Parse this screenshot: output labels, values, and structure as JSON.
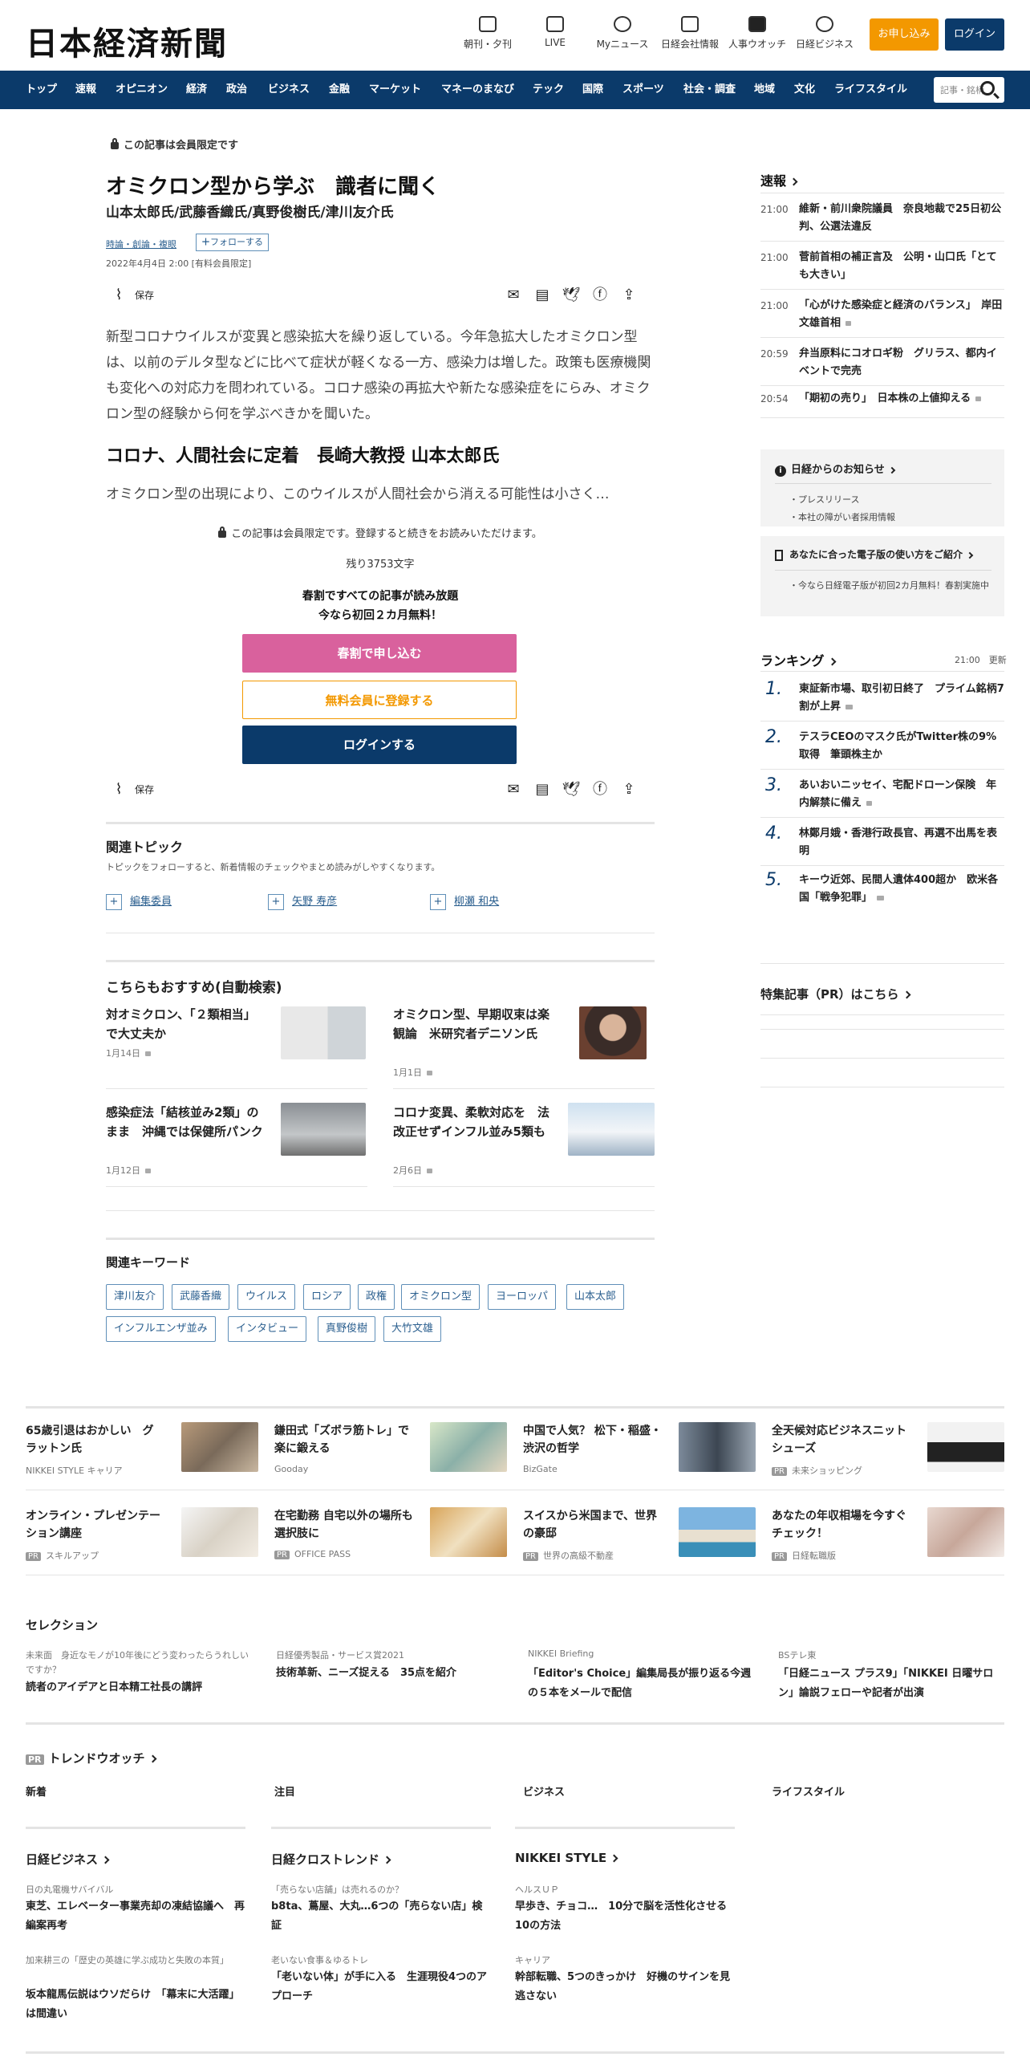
{
  "header": {
    "logo": "日本経済新聞",
    "icons": [
      {
        "label": "朝刊・夕刊",
        "icon": "newspaper-icon"
      },
      {
        "label": "LIVE",
        "icon": "video-icon"
      },
      {
        "label": "Myニュース",
        "icon": "person-icon"
      },
      {
        "label": "日経会社情報",
        "icon": "chart-icon"
      },
      {
        "label": "人事ウオッチ",
        "icon": "search-person-icon"
      },
      {
        "label": "日経ビジネス",
        "icon": "compass-icon"
      }
    ],
    "apply_label": "お申し込み",
    "login_label": "ログイン"
  },
  "nav": {
    "items": [
      "トップ",
      "速報",
      "オピニオン",
      "経済",
      "政治",
      "ビジネス",
      "金融",
      "マーケット",
      "マネーのまなび",
      "テック",
      "国際",
      "スポーツ",
      "社会・調査",
      "地域",
      "文化",
      "ライフスタイル"
    ],
    "search_placeholder": "記事・銘柄"
  },
  "article": {
    "members_only": "この記事は会員限定です",
    "title": "オミクロン型から学ぶ　識者に聞く",
    "authors": "山本太郎氏/武藤香織氏/真野俊樹氏/津川友介氏",
    "category": "時論・創論・複眼",
    "follow_label": "フォローする",
    "date": "2022年4月4日 2:00 [有料会員限定]",
    "save_label": "保存",
    "lead": "新型コロナウイルスが変異と感染拡大を繰り返している。今年急拡大したオミクロン型は、以前のデルタ型などに比べて症状が軽くなる一方、感染力は増した。政策も医療機関も変化への対応力を問われている。コロナ感染の再拡大や新たな感染症をにらみ、オミクロン型の経験から何を学ぶべきかを聞いた。",
    "subhead": "コロナ、人間社会に定着　長崎大教授 山本太郎氏",
    "teaser": "オミクロン型の出現により、このウイルスが人間社会から消える可能性は小さく…",
    "paywall_note": "この記事は会員限定です。登録すると続きをお読みいただけます。",
    "remaining": "残り3753文字",
    "promo_line1": "春割ですべての記事が読み放題",
    "promo_line2": "今なら初回２カ月無料！",
    "btn_spring": "春割で申し込む",
    "btn_register": "無料会員に登録する",
    "btn_login": "ログインする"
  },
  "related_topics": {
    "heading": "関連トピック",
    "desc": "トピックをフォローすると、新着情報のチェックやまとめ読みがしやすくなります。",
    "items": [
      "編集委員",
      "矢野 寿彦",
      "柳瀬 和央"
    ]
  },
  "recommend": {
    "heading": "こちらもおすすめ(自動検索)",
    "items": [
      {
        "title": "対オミクロン、「２類相当」で大丈夫か",
        "date": "1月14日"
      },
      {
        "title": "オミクロン型、早期収束は楽観論　米研究者デニソン氏",
        "date": "1月1日"
      },
      {
        "title": "感染症法「結核並み2類」のまま　沖縄では保健所パンク",
        "date": "1月12日"
      },
      {
        "title": "コロナ変異、柔軟対応を　法改正せずインフル並み5類も",
        "date": "2月6日"
      }
    ]
  },
  "keywords": {
    "heading": "関連キーワード",
    "items": [
      "津川友介",
      "武藤香織",
      "ウイルス",
      "ロシア",
      "政権",
      "オミクロン型",
      "ヨーロッパ",
      "山本太郎",
      "インフルエンザ並み",
      "インタビュー",
      "真野俊樹",
      "大竹文雄"
    ]
  },
  "sidebar": {
    "sokuho_heading": "速報",
    "news": [
      {
        "time": "21:00",
        "text": "維新・前川衆院議員　奈良地裁で25日初公判、公選法違反",
        "locked": false
      },
      {
        "time": "21:00",
        "text": "菅前首相の補正言及　公明・山口氏「とても大きい」",
        "locked": false
      },
      {
        "time": "21:00",
        "text": "「心がけた感染症と経済のバランス」　岸田文雄首相",
        "locked": true
      },
      {
        "time": "20:59",
        "text": "弁当原料にコオロギ粉　グリラス、都内イベントで完売",
        "locked": false
      },
      {
        "time": "20:54",
        "text": "「期初の売り」　日本株の上値抑える",
        "locked": true
      }
    ],
    "notice_heading": "日経からのお知らせ",
    "notice_items": [
      "プレスリリース",
      "本社の障がい者採用情報"
    ],
    "guide_heading": "あなたに合った電子版の使い方をご紹介",
    "guide_items": [
      "今なら日経電子版が初回2カ月無料！春割実施中"
    ],
    "ranking_heading": "ランキング",
    "ranking_time": "21:00",
    "ranking_update": "更新",
    "ranking": [
      {
        "rank": "1.",
        "text": "東証新市場、取引初日終了　プライム銘柄7割が上昇",
        "video": true
      },
      {
        "rank": "2.",
        "text": "テスラCEOのマスク氏がTwitter株の9%取得　筆頭株主か",
        "video": false
      },
      {
        "rank": "3.",
        "text": "あいおいニッセイ、宅配ドローン保険　年内解禁に備え",
        "video": false
      },
      {
        "rank": "4.",
        "text": "林鄭月娥・香港行政長官、再選不出馬を表明",
        "video": false
      },
      {
        "rank": "5.",
        "text": "キーウ近郊、民間人遺体400超か　欧米各国「戦争犯罪」",
        "video": true
      }
    ],
    "tokushu": "特集記事（PR）はこちら"
  },
  "bottom_grid": [
    {
      "title": "65歳引退はおかしい　グラットン氏",
      "source": "NIKKEI STYLE キャリア",
      "pr": false
    },
    {
      "title": "鎌田式「ズボラ筋トレ」で楽に鍛える",
      "source": "Gooday",
      "pr": false
    },
    {
      "title": "中国で人気？ 松下・稲盛・渋沢の哲学",
      "source": "BizGate",
      "pr": false
    },
    {
      "title": "全天候対応ビジネスニットシューズ",
      "source": "未来ショッピング",
      "pr": true
    },
    {
      "title": "オンライン・プレゼンテーション講座",
      "source": "スキルアップ",
      "pr": true
    },
    {
      "title": "在宅勤務 自宅以外の場所も選択肢に",
      "source": "OFFICE PASS",
      "pr": true
    },
    {
      "title": "スイスから米国まで、世界の豪邸",
      "source": "世界の高級不動産",
      "pr": true
    },
    {
      "title": "あなたの年収相場を今すぐチェック！",
      "source": "日経転職版",
      "pr": true
    }
  ],
  "selection": {
    "heading": "セレクション",
    "items": [
      {
        "kicker": "未来面　身近なモノが10年後にどう変わったらうれしいですか？",
        "title": "読者のアイデアと日本精工社長の講評"
      },
      {
        "kicker": "日経優秀製品・サービス賞2021",
        "title": "技術革新、ニーズ捉える　35点を紹介"
      },
      {
        "kicker": "NIKKEI Briefing",
        "title": "「Editor's Choice」編集局長が振り返る今週の５本をメールで配信"
      },
      {
        "kicker": "BSテレ東",
        "title": "「日経ニュース プラス9」「NIKKEI 日曜サロン」論説フェローや記者が出演"
      }
    ]
  },
  "trend": {
    "heading": "トレンドウオッチ",
    "pr": "PR",
    "tabs": [
      "新着",
      "注目",
      "ビジネス",
      "ライフスタイル"
    ]
  },
  "partners": [
    {
      "heading": "日経ビジネス",
      "items": [
        {
          "kicker": "日の丸電機サバイバル",
          "title": "東芝、エレベーター事業売却の凍結協議へ　再編案再考"
        },
        {
          "kicker": "加来耕三の「歴史の英雄に学ぶ成功と失敗の本質」",
          "title": "坂本龍馬伝説はウソだらけ　「幕末に大活躍」は間違い"
        }
      ]
    },
    {
      "heading": "日経クロストレンド",
      "items": [
        {
          "kicker": "「売らない店舗」は売れるのか？",
          "title": "b8ta、蔦屋、大丸…6つの「売らない店」検証"
        },
        {
          "kicker": "老いない食事＆ゆるトレ",
          "title": "「老いない体」が手に入る　生涯現役4つのアプローチ"
        }
      ]
    },
    {
      "heading": "NIKKEI STYLE",
      "items": [
        {
          "kicker": "ヘルスＵＰ",
          "title": "早歩き、チョコ…　10分で脳を活性化させる10の方法"
        },
        {
          "kicker": "キャリア",
          "title": "幹部転職、5つのきっかけ　好機のサインを見逃さない"
        }
      ]
    }
  ]
}
